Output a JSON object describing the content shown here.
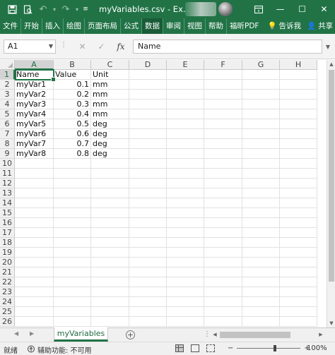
{
  "titlebar": {
    "title": "myVariables.csv  -  Ex...",
    "minimize": "—",
    "maximize": "☐",
    "close": "✕"
  },
  "ribbon": {
    "tabs": [
      "文件",
      "开始",
      "插入",
      "绘图",
      "页面布局",
      "公式",
      "数据",
      "审阅",
      "视图",
      "帮助",
      "福昕PDF"
    ],
    "selected": "数据",
    "tell_me": "告诉我",
    "share": "共享"
  },
  "formula_bar": {
    "name_box": "A1",
    "cancel": "✕",
    "enter": "✓",
    "fx": "fx",
    "content": "Name"
  },
  "columns": [
    "A",
    "B",
    "C",
    "D",
    "E",
    "F",
    "G",
    "H"
  ],
  "rows": [
    "1",
    "2",
    "3",
    "4",
    "5",
    "6",
    "7",
    "8",
    "9",
    "10",
    "11",
    "12",
    "13",
    "14",
    "15",
    "16",
    "17",
    "18",
    "19",
    "20",
    "21",
    "22",
    "23",
    "24",
    "25",
    "26"
  ],
  "cells": [
    [
      "Name",
      "Value",
      "Unit"
    ],
    [
      "myVar1",
      "0.1",
      "mm"
    ],
    [
      "myVar2",
      "0.2",
      "mm"
    ],
    [
      "myVar3",
      "0.3",
      "mm"
    ],
    [
      "myVar4",
      "0.4",
      "mm"
    ],
    [
      "myVar5",
      "0.5",
      "deg"
    ],
    [
      "myVar6",
      "0.6",
      "deg"
    ],
    [
      "myVar7",
      "0.7",
      "deg"
    ],
    [
      "myVar8",
      "0.8",
      "deg"
    ]
  ],
  "sheets": {
    "active": "myVariables",
    "add": "+"
  },
  "status": {
    "ready": "就绪",
    "accessibility": "辅助功能: 不可用",
    "zoom_minus": "−",
    "zoom_plus": "+",
    "zoom": "100%"
  },
  "colors": {
    "accent": "#217346",
    "ribbon_selected": "#185c37"
  }
}
